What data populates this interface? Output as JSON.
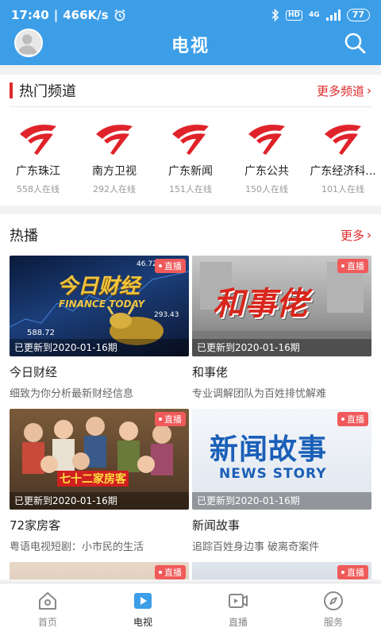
{
  "status_bar": {
    "time": "17:40",
    "speed": "466K/s",
    "hd": "HD",
    "network": "4G",
    "battery": "77"
  },
  "header": {
    "title": "电视"
  },
  "hot_channels": {
    "title": "热门频道",
    "more": "更多频道",
    "items": [
      {
        "name": "广东珠江",
        "viewers": "558人在线"
      },
      {
        "name": "南方卫视",
        "viewers": "292人在线"
      },
      {
        "name": "广东新闻",
        "viewers": "151人在线"
      },
      {
        "name": "广东公共",
        "viewers": "150人在线"
      },
      {
        "name": "广东经济科...",
        "viewers": "101人在线"
      }
    ]
  },
  "hot_broadcast": {
    "title": "热播",
    "more": "更多",
    "live_label": "直播",
    "items": [
      {
        "name": "今日财经",
        "desc": "细致为你分析最新财经信息",
        "updated": "已更新到2020-01-16期",
        "thumb_text": "今日财经",
        "thumb_sub": "FINANCE TODAY",
        "thumb_nums": [
          "588.72",
          "46.72",
          "293.43"
        ]
      },
      {
        "name": "和事佬",
        "desc": "专业调解团队为百姓排忧解难",
        "updated": "已更新到2020-01-16期",
        "thumb_text": "和事佬"
      },
      {
        "name": "72家房客",
        "desc": "粤语电视短剧：小市民的生活",
        "updated": "已更新到2020-01-16期",
        "thumb_text": "七十二家房客"
      },
      {
        "name": "新闻故事",
        "desc": "追踪百姓身边事 破离奇案件",
        "updated": "已更新到2020-01-16期",
        "thumb_text": "新闻故事",
        "thumb_sub": "NEWS STORY"
      }
    ]
  },
  "bottom_nav": [
    {
      "label": "首页",
      "icon": "home-icon"
    },
    {
      "label": "电视",
      "icon": "tv-play-icon"
    },
    {
      "label": "直播",
      "icon": "live-video-icon"
    },
    {
      "label": "服务",
      "icon": "compass-icon"
    }
  ],
  "colors": {
    "primary": "#3d9ee8",
    "accent": "#e02a2a"
  }
}
